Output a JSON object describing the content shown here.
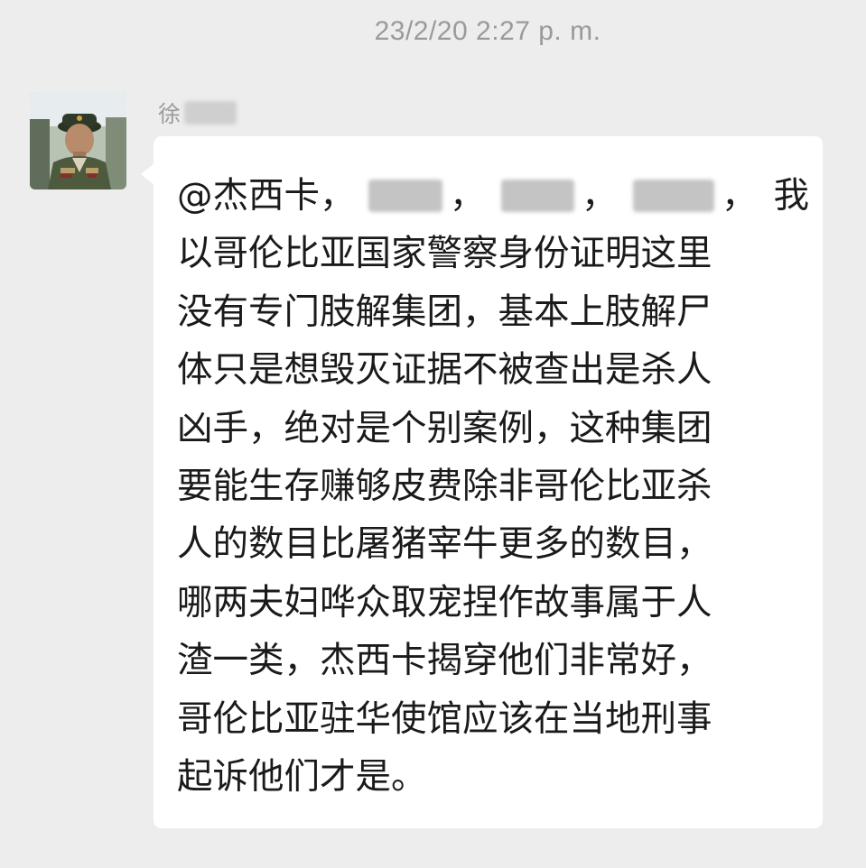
{
  "header": {
    "timestamp": "23/2/20 2:27 p. m."
  },
  "message": {
    "sender_visible_prefix": "徐",
    "avatar_icon": "user-avatar-photo",
    "mention": "@杰西卡",
    "separator": "，",
    "first_line_tail": "我",
    "lines": [
      "以哥伦比亚国家警察身份证明这里",
      "没有专门肢解集团，基本上肢解尸",
      "体只是想毁灭证据不被查出是杀人",
      "凶手，绝对是个别案例，这种集团",
      "要能生存赚够皮费除非哥伦比亚杀",
      "人的数目比屠猪宰牛更多的数目，",
      "哪两夫妇哗众取宠捏作故事属于人",
      "渣一类，杰西卡揭穿他们非常好，",
      "哥伦比亚驻华使馆应该在当地刑事",
      "起诉他们才是。"
    ]
  },
  "colors": {
    "background": "#ededed",
    "bubble": "#ffffff",
    "timestamp_text": "#9a9a9a",
    "message_text": "#1a1a1a"
  }
}
